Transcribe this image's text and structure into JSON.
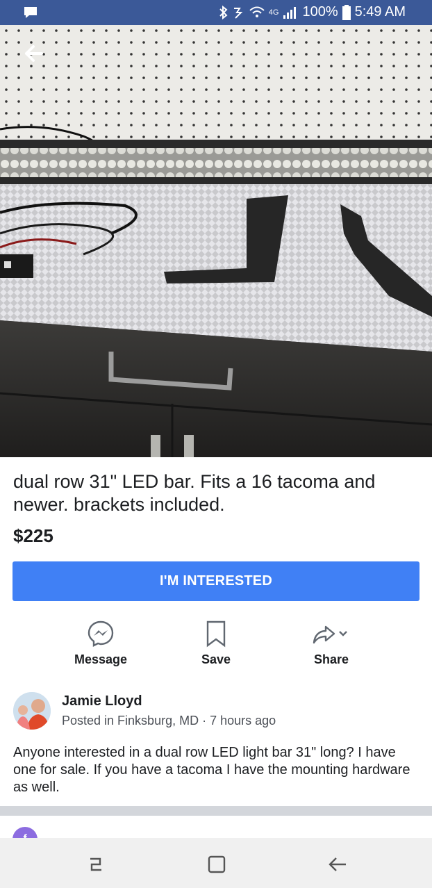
{
  "status_bar": {
    "network": "4G",
    "battery": "100%",
    "time": "5:49 AM"
  },
  "listing": {
    "title": "dual row 31\" LED bar. Fits a 16 tacoma and newer. brackets included.",
    "price": "$225",
    "interested_button": "I'M INTERESTED"
  },
  "actions": [
    {
      "label": "Message",
      "icon": "messenger-icon"
    },
    {
      "label": "Save",
      "icon": "bookmark-icon"
    },
    {
      "label": "Share",
      "icon": "share-icon"
    }
  ],
  "seller": {
    "name": "Jamie Lloyd",
    "posted": "Posted in Finksburg, MD · 7 hours ago"
  },
  "description": "Anyone interested in a dual row LED light bar 31\" long? I have one for sale. If you have a tacoma I have the mounting hardware as well.",
  "colors": {
    "status_bar": "#3b5998",
    "button": "#4080f5"
  }
}
